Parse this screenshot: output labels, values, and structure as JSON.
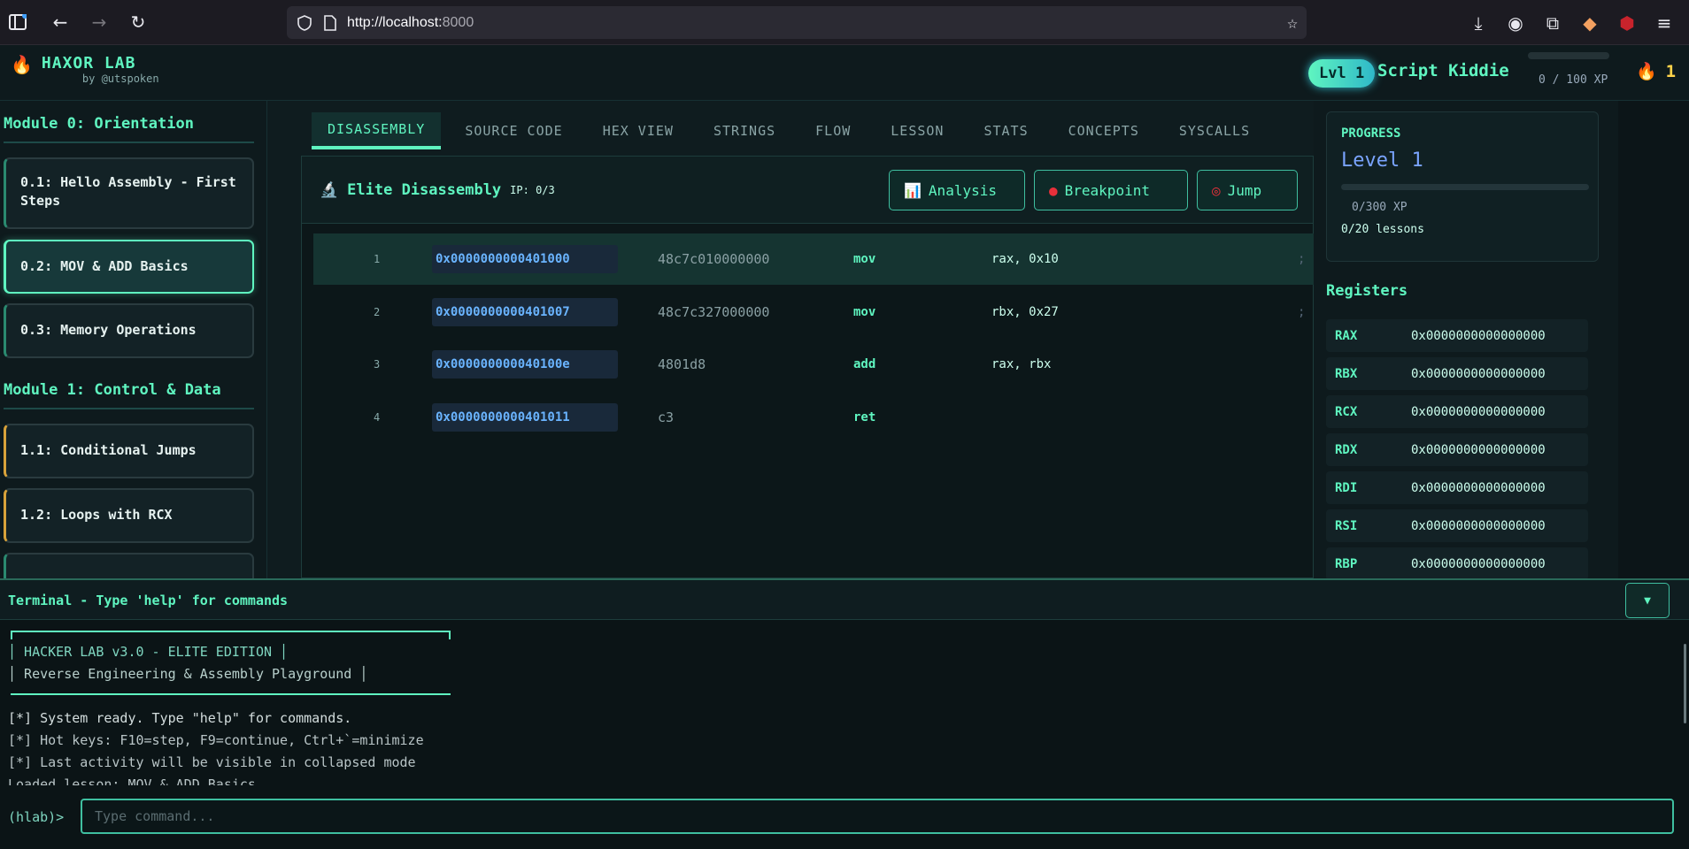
{
  "browser": {
    "url_host": "http://localhost:",
    "url_port": "8000",
    "icons": [
      "sidebar-icon",
      "back-icon",
      "forward-icon",
      "reload-icon",
      "shield-icon",
      "page-icon",
      "star-icon",
      "download-icon",
      "account-icon",
      "extensions-icon",
      "addon-icon",
      "ublock-icon",
      "menu-icon"
    ]
  },
  "header": {
    "logo_title": "HAXOR LAB",
    "logo_subtitle": "by @utspoken",
    "level_badge": "Lvl 1",
    "rank": "Script Kiddie",
    "xp_text": "0 / 100 XP",
    "xp_fraction": 0,
    "streak": "1"
  },
  "sidebar": {
    "modules": [
      {
        "title": "Module 0: Orientation",
        "lessons": [
          {
            "label": "0.1: Hello Assembly - First Steps"
          },
          {
            "label": "0.2: MOV & ADD Basics"
          },
          {
            "label": "0.3: Memory Operations"
          }
        ]
      },
      {
        "title": "Module 1: Control & Data",
        "lessons": [
          {
            "label": "1.1: Conditional Jumps"
          },
          {
            "label": "1.2: Loops with RCX"
          }
        ]
      }
    ]
  },
  "tabs": [
    {
      "label": "DISASSEMBLY"
    },
    {
      "label": "SOURCE CODE"
    },
    {
      "label": "HEX VIEW"
    },
    {
      "label": "STRINGS"
    },
    {
      "label": "FLOW"
    },
    {
      "label": "LESSON"
    },
    {
      "label": "STATS"
    },
    {
      "label": "CONCEPTS"
    },
    {
      "label": "SYSCALLS"
    }
  ],
  "disasm": {
    "title": "Elite Disassembly",
    "ip": "IP: 0/3",
    "buttons": {
      "analysis": "Analysis",
      "breakpoint": "Breakpoint",
      "jump": "Jump"
    },
    "rows": [
      {
        "n": "1",
        "addr": "0x0000000000401000",
        "bytes": "48c7c010000000",
        "mnemonic": "mov",
        "operands": "rax, 0x10",
        "comment": ";"
      },
      {
        "n": "2",
        "addr": "0x0000000000401007",
        "bytes": "48c7c327000000",
        "mnemonic": "mov",
        "operands": "rbx, 0x27",
        "comment": ";"
      },
      {
        "n": "3",
        "addr": "0x000000000040100e",
        "bytes": "4801d8",
        "mnemonic": "add",
        "operands": "rax, rbx",
        "comment": ""
      },
      {
        "n": "4",
        "addr": "0x0000000000401011",
        "bytes": "c3",
        "mnemonic": "ret",
        "operands": "",
        "comment": ""
      }
    ]
  },
  "progress": {
    "label": "PROGRESS",
    "level": "Level 1",
    "xp": "0/300 XP",
    "lessons": "0/20 lessons",
    "fraction": 0
  },
  "registers": {
    "title": "Registers",
    "items": [
      {
        "name": "RAX",
        "value": "0x0000000000000000"
      },
      {
        "name": "RBX",
        "value": "0x0000000000000000"
      },
      {
        "name": "RCX",
        "value": "0x0000000000000000"
      },
      {
        "name": "RDX",
        "value": "0x0000000000000000"
      },
      {
        "name": "RDI",
        "value": "0x0000000000000000"
      },
      {
        "name": "RSI",
        "value": "0x0000000000000000"
      },
      {
        "name": "RBP",
        "value": "0x0000000000000000"
      }
    ]
  },
  "terminal": {
    "title": "Terminal - Type 'help' for commands",
    "toggle": "▼",
    "banner_line1": "│ HACKER LAB v3.0 - ELITE EDITION │",
    "banner_line2": "│ Reverse Engineering & Assembly Playground │",
    "lines": [
      "[*] System ready. Type \"help\" for commands.",
      "[*] Hot keys: F10=step, F9=continue, Ctrl+`=minimize",
      "[*] Last activity will be visible in collapsed mode",
      "Loaded lesson: MOV & ADD Basics"
    ],
    "prompt": "(hlab)>",
    "placeholder": "Type command..."
  }
}
